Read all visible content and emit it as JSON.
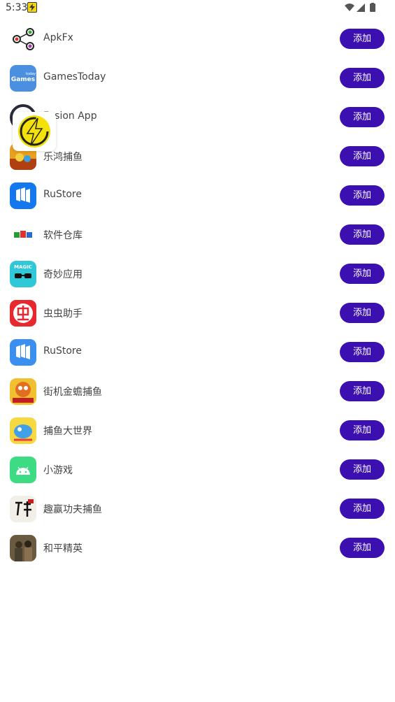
{
  "status_bar": {
    "time": "5:33",
    "icons": [
      "flash-notification-icon",
      "wifi-icon",
      "signal-icon",
      "battery-icon"
    ]
  },
  "button_label": "添加",
  "accent_color": "#3b0fb0",
  "apps": [
    {
      "name": "ApkFx",
      "icon": "apkfx-share-icon"
    },
    {
      "name": "GamesToday",
      "icon": "gamestoday-icon"
    },
    {
      "name": "Fusion App",
      "icon": "fusion-app-icon"
    },
    {
      "name": "乐鸿捕鱼",
      "icon": "fishing-game-icon"
    },
    {
      "name": "RuStore",
      "icon": "rustore-icon"
    },
    {
      "name": "软件仓库",
      "icon": "software-repo-icon"
    },
    {
      "name": "奇妙应用",
      "icon": "magic-app-icon"
    },
    {
      "name": "虫虫助手",
      "icon": "chongchong-icon"
    },
    {
      "name": "RuStore",
      "icon": "rustore-icon"
    },
    {
      "name": "街机金蟾捕鱼",
      "icon": "arcade-fishing-icon"
    },
    {
      "name": "捕鱼大世界",
      "icon": "fishing-world-icon"
    },
    {
      "name": "小游戏",
      "icon": "android-icon"
    },
    {
      "name": "趣赢功夫捕鱼",
      "icon": "kungfu-fishing-icon"
    },
    {
      "name": "和平精英",
      "icon": "peace-elite-icon"
    }
  ],
  "overlay": {
    "icon": "lightning-bolt-icon"
  }
}
